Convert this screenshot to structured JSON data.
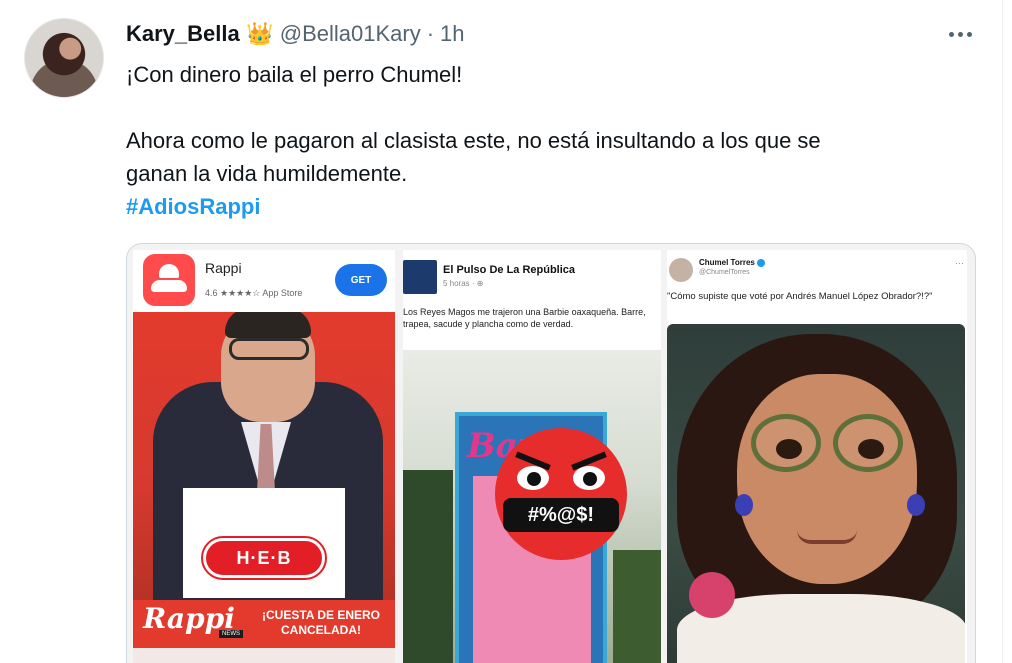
{
  "tweet": {
    "display_name": "Kary_Bella",
    "crown_glyph": "👑",
    "handle": "@Bella01Kary",
    "separator": "·",
    "time": "1h",
    "line1": "¡Con dinero baila el perro Chumel!",
    "line2": "Ahora como le pagaron al clasista este, no está insultando a los que se",
    "line3": "ganan la vida humildemente.",
    "hashtag": "#AdiosRappi"
  },
  "media": {
    "panel1": {
      "app_name": "Rappi",
      "rating": "4.6 ★★★★☆ App Store",
      "get_label": "GET",
      "heb_logo": "H·E·B",
      "brand": "Rappi",
      "news_tag": "NEWS",
      "banner_text": "¡CUESTA DE ENERO CANCELADA!"
    },
    "panel2": {
      "account_name": "El Pulso De La República",
      "meta": "5 horas · ⊕",
      "text": "Los Reyes Magos me trajeron una Barbie oaxaqueña. Barre, trapea, sacude y plancha como de verdad.",
      "box_brand": "Barbie",
      "censor_text": "#%@$!"
    },
    "panel3": {
      "account_name": "Chumel Torres",
      "account_handle": "@ChumelTorres",
      "more": "···",
      "text": "\"Cómo supiste que voté por Andrés Manuel López Obrador?!?\""
    }
  },
  "colors": {
    "hashtag": "#1d9bf0",
    "secondary_text": "#536471",
    "rappi_red": "#e23b2d"
  },
  "icons": [
    "crown-icon",
    "more-options-icon",
    "verified-icon"
  ]
}
